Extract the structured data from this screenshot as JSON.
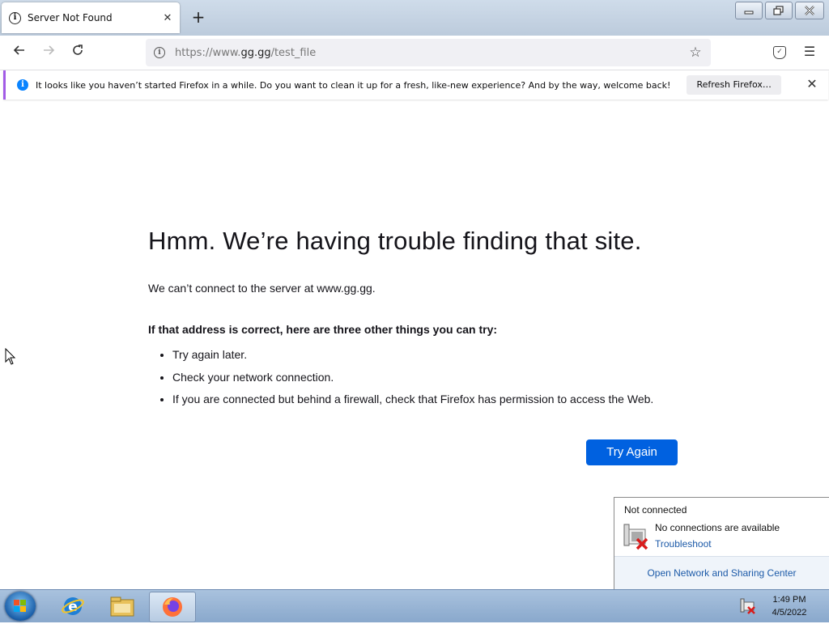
{
  "browser": {
    "tab_title": "Server Not Found",
    "tab_close": "✕",
    "new_tab": "+",
    "url_prefix": "https://www.",
    "url_domain": "gg.gg",
    "url_path": "/test_file",
    "window_controls": [
      "minimize",
      "restore",
      "close"
    ]
  },
  "notification": {
    "text": "It looks like you haven’t started Firefox in a while. Do you want to clean it up for a fresh, like-new experience? And by the way, welcome back!",
    "button_label": "Refresh Firefox…",
    "close": "✕"
  },
  "error_page": {
    "title": "Hmm. We’re having trouble finding that site.",
    "description": "We can’t connect to the server at www.gg.gg.",
    "subheading": "If that address is correct, here are three other things you can try:",
    "suggestions": [
      "Try again later.",
      "Check your network connection.",
      "If you are connected but behind a firewall, check that Firefox has permission to access the Web."
    ],
    "try_again_label": "Try Again"
  },
  "network_popup": {
    "status": "Not connected",
    "message": "No connections are available",
    "troubleshoot_link": "Troubleshoot",
    "footer_link": "Open Network and Sharing Center"
  },
  "taskbar": {
    "time": "1:49 PM",
    "date": "4/5/2022",
    "pinned": [
      "internet-explorer-icon",
      "file-explorer-icon",
      "firefox-icon"
    ]
  },
  "colors": {
    "accent_blue": "#0061e0",
    "link_blue": "#1c5aa8",
    "notification_accent": "#a25be6"
  }
}
